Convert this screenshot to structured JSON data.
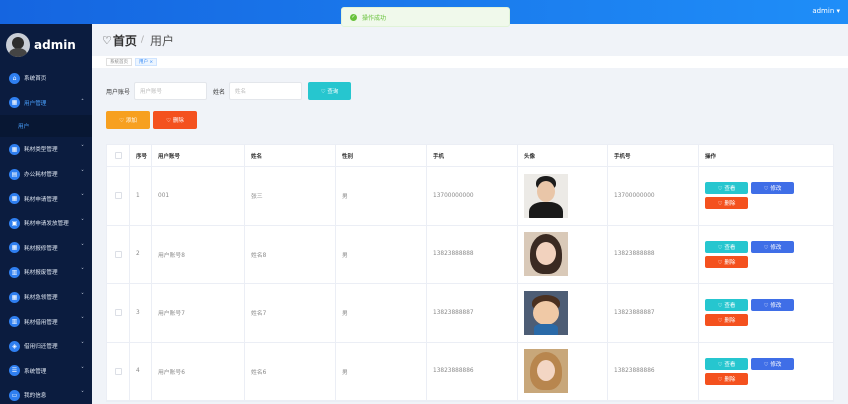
{
  "topbar": {
    "user": "admin ▾"
  },
  "toast": {
    "text": "操作成功"
  },
  "sidebar": {
    "brand": "admin",
    "items": [
      {
        "label": "系统首页",
        "icon": "home-icon",
        "glyph": "⌂",
        "chev": ""
      },
      {
        "label": "用户管理",
        "icon": "grid-icon",
        "glyph": "▦",
        "chev": "ˆ"
      },
      {
        "label": "耗材类型管理",
        "icon": "grid-icon",
        "glyph": "▦",
        "chev": "ˇ"
      },
      {
        "label": "办公耗材管理",
        "icon": "folder-icon",
        "glyph": "▤",
        "chev": "ˇ"
      },
      {
        "label": "耗材申请管理",
        "icon": "grid-icon",
        "glyph": "▦",
        "chev": "ˇ"
      },
      {
        "label": "耗材申请发放管理",
        "icon": "chat-icon",
        "glyph": "▣",
        "chev": "ˇ"
      },
      {
        "label": "耗材报修管理",
        "icon": "grid-icon",
        "glyph": "▦",
        "chev": "ˇ"
      },
      {
        "label": "耗材报废管理",
        "icon": "chart-icon",
        "glyph": "▥",
        "chev": "ˇ"
      },
      {
        "label": "耗材急领管理",
        "icon": "grid-icon",
        "glyph": "▦",
        "chev": "ˇ"
      },
      {
        "label": "耗材借用管理",
        "icon": "chart-icon",
        "glyph": "▥",
        "chev": "ˇ"
      },
      {
        "label": "借用归还管理",
        "icon": "shield-icon",
        "glyph": "◈",
        "chev": "ˇ"
      },
      {
        "label": "系统管理",
        "icon": "list-icon",
        "glyph": "☰",
        "chev": "ˇ"
      },
      {
        "label": "我的信息",
        "icon": "id-card-icon",
        "glyph": "▭",
        "chev": "ˇ"
      }
    ],
    "submenu": "用户"
  },
  "header": {
    "home": "首页",
    "separator": "/",
    "current": "用户"
  },
  "tags": [
    {
      "label": "系统首页"
    },
    {
      "label": "用户 ×"
    }
  ],
  "search": {
    "account_label": "用户账号",
    "account_placeholder": "用户账号",
    "name_label": "姓名",
    "name_placeholder": "姓名",
    "query_label": "♡ 查询"
  },
  "toolbar": {
    "add_label": "♡ 添加",
    "delete_label": "♡ 删除"
  },
  "table": {
    "headers": [
      "序号",
      "用户账号",
      "姓名",
      "性别",
      "手机",
      "头像",
      "手机号",
      "操作"
    ],
    "rows": [
      {
        "idx": "1",
        "account": "001",
        "name": "张三",
        "sex": "男",
        "phone": "13700000000",
        "tel": "13700000000",
        "avatar": "man"
      },
      {
        "idx": "2",
        "account": "用户账号8",
        "name": "姓名8",
        "sex": "男",
        "phone": "13823888888",
        "tel": "13823888888",
        "avatar": "girl"
      },
      {
        "idx": "3",
        "account": "用户账号7",
        "name": "姓名7",
        "sex": "男",
        "phone": "13823888887",
        "tel": "13823888887",
        "avatar": "toon"
      },
      {
        "idx": "4",
        "account": "用户账号6",
        "name": "姓名6",
        "sex": "男",
        "phone": "13823888886",
        "tel": "13823888886",
        "avatar": "woman"
      }
    ],
    "view_label": "♡ 查看",
    "edit_label": "♡ 修改",
    "delete_label": "♡ 删除"
  },
  "colors": {
    "topbar": "#1f8ef8",
    "sidebar": "#0b1c3f",
    "accent": "#2f86f6",
    "query": "#26c6cf",
    "add": "#f7a020",
    "delete": "#f4511e",
    "edit": "#3f6ee7"
  }
}
